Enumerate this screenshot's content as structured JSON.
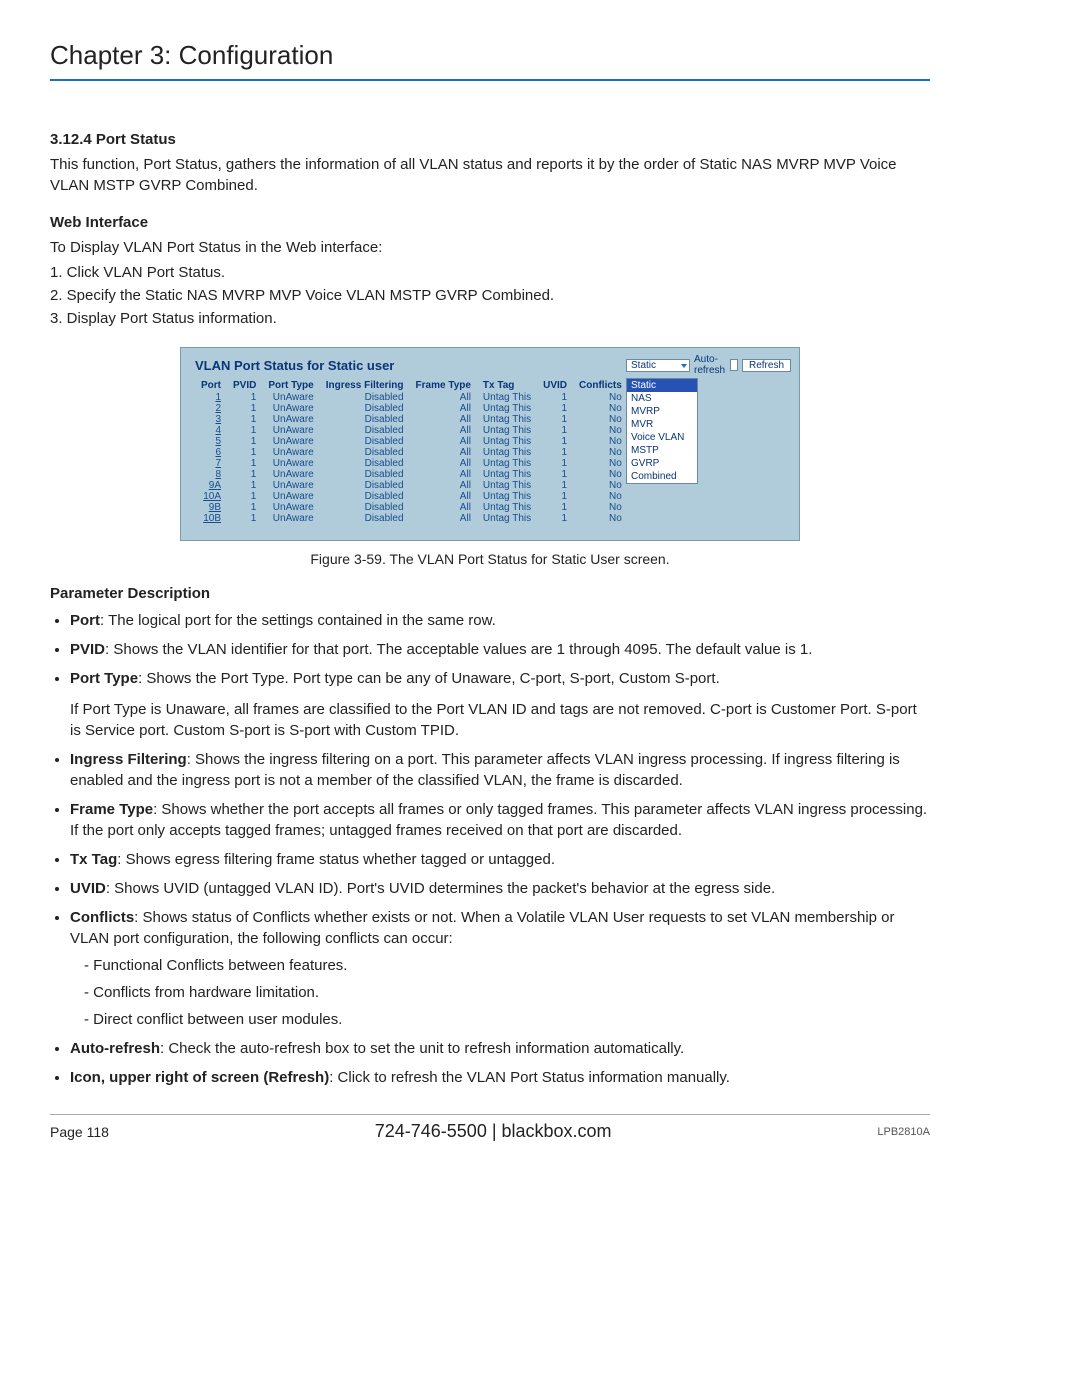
{
  "chapter_title": "Chapter 3: Configuration",
  "section": {
    "number": "3.12.4",
    "title": "Port Status",
    "intro": "This function, Port Status, gathers the information of all VLAN status and reports it by the order of Static NAS MVRP MVP Voice VLAN MSTP GVRP Combined.",
    "web_interface_heading": "Web Interface",
    "web_interface_intro": "To Display VLAN Port Status in the Web interface:",
    "steps": [
      "1. Click VLAN Port Status.",
      "2. Specify the Static NAS MVRP MVP Voice VLAN MSTP GVRP Combined.",
      "3. Display Port Status information."
    ]
  },
  "figure": {
    "title": "VLAN Port Status for Static user",
    "headers": [
      "Port",
      "PVID",
      "Port Type",
      "Ingress Filtering",
      "Frame Type",
      "Tx Tag",
      "UVID",
      "Conflicts"
    ],
    "rows": [
      {
        "port": "1",
        "pvid": "1",
        "ptype": "UnAware",
        "ifilt": "Disabled",
        "ftype": "All",
        "txtag": "Untag This",
        "uvid": "1",
        "conf": "No"
      },
      {
        "port": "2",
        "pvid": "1",
        "ptype": "UnAware",
        "ifilt": "Disabled",
        "ftype": "All",
        "txtag": "Untag This",
        "uvid": "1",
        "conf": "No"
      },
      {
        "port": "3",
        "pvid": "1",
        "ptype": "UnAware",
        "ifilt": "Disabled",
        "ftype": "All",
        "txtag": "Untag This",
        "uvid": "1",
        "conf": "No"
      },
      {
        "port": "4",
        "pvid": "1",
        "ptype": "UnAware",
        "ifilt": "Disabled",
        "ftype": "All",
        "txtag": "Untag This",
        "uvid": "1",
        "conf": "No"
      },
      {
        "port": "5",
        "pvid": "1",
        "ptype": "UnAware",
        "ifilt": "Disabled",
        "ftype": "All",
        "txtag": "Untag This",
        "uvid": "1",
        "conf": "No"
      },
      {
        "port": "6",
        "pvid": "1",
        "ptype": "UnAware",
        "ifilt": "Disabled",
        "ftype": "All",
        "txtag": "Untag This",
        "uvid": "1",
        "conf": "No"
      },
      {
        "port": "7",
        "pvid": "1",
        "ptype": "UnAware",
        "ifilt": "Disabled",
        "ftype": "All",
        "txtag": "Untag This",
        "uvid": "1",
        "conf": "No"
      },
      {
        "port": "8",
        "pvid": "1",
        "ptype": "UnAware",
        "ifilt": "Disabled",
        "ftype": "All",
        "txtag": "Untag This",
        "uvid": "1",
        "conf": "No"
      },
      {
        "port": "9A",
        "pvid": "1",
        "ptype": "UnAware",
        "ifilt": "Disabled",
        "ftype": "All",
        "txtag": "Untag This",
        "uvid": "1",
        "conf": "No"
      },
      {
        "port": "10A",
        "pvid": "1",
        "ptype": "UnAware",
        "ifilt": "Disabled",
        "ftype": "All",
        "txtag": "Untag This",
        "uvid": "1",
        "conf": "No"
      },
      {
        "port": "9B",
        "pvid": "1",
        "ptype": "UnAware",
        "ifilt": "Disabled",
        "ftype": "All",
        "txtag": "Untag This",
        "uvid": "1",
        "conf": "No"
      },
      {
        "port": "10B",
        "pvid": "1",
        "ptype": "UnAware",
        "ifilt": "Disabled",
        "ftype": "All",
        "txtag": "Untag This",
        "uvid": "1",
        "conf": "No"
      }
    ],
    "toolbar": {
      "dropdown_value": "Static",
      "auto_refresh_label": "Auto-refresh",
      "refresh_btn": "Refresh"
    },
    "dropdown_options": [
      "Static",
      "NAS",
      "MVRP",
      "MVR",
      "Voice VLAN",
      "MSTP",
      "GVRP",
      "Combined"
    ],
    "caption": "Figure 3-59. The VLAN Port Status for Static User screen."
  },
  "param_heading": "Parameter Description",
  "params": {
    "port": {
      "name": "Port",
      "desc": ": The logical port for the settings contained in the same row."
    },
    "pvid": {
      "name": "PVID",
      "desc": ": Shows the VLAN identifier for that port. The acceptable values are 1 through 4095. The default value is 1."
    },
    "ptype": {
      "name": "Port Type",
      "desc": ": Shows the Port Type. Port type can be any of Unaware, C-port, S-port, Custom S-port.",
      "extra": "If Port Type is Unaware, all frames are classified to the Port VLAN ID and tags are not removed. C-port is Customer Port. S-port is Service port. Custom S-port is S-port with Custom TPID."
    },
    "ifilt": {
      "name": "Ingress Filtering",
      "desc": ": Shows the ingress filtering on a port. This parameter affects VLAN ingress processing. If ingress filtering is enabled and the ingress port is not a member of the classified VLAN, the frame is discarded."
    },
    "ftype": {
      "name": "Frame Type",
      "desc": ": Shows whether the port accepts all frames or only tagged frames. This parameter affects VLAN ingress processing. If the port only accepts tagged frames; untagged frames received on that port are discarded."
    },
    "txtag": {
      "name": "Tx Tag",
      "desc": ": Shows egress filtering frame status whether tagged or untagged."
    },
    "uvid": {
      "name": "UVID",
      "desc": ": Shows UVID (untagged VLAN ID). Port's UVID determines the packet's behavior at the egress side."
    },
    "conf": {
      "name": "Conflicts",
      "desc": ": Shows status of Conflicts whether exists or not. When a Volatile VLAN User requests to set VLAN membership or VLAN port configuration, the following conflicts can occur:",
      "sub": [
        "- Functional Conflicts between features.",
        "- Conflicts from hardware limitation.",
        "- Direct conflict between user modules."
      ]
    },
    "arefresh": {
      "name": "Auto-refresh",
      "desc": ": Check the auto-refresh box to set the unit to refresh information automatically."
    },
    "refresh": {
      "name": "Icon, upper right of screen (Refresh)",
      "desc": ": Click to refresh the VLAN Port Status information manually."
    }
  },
  "footer": {
    "page": "Page 118",
    "center": "724-746-5500    |    blackbox.com",
    "model": "LPB2810A"
  }
}
